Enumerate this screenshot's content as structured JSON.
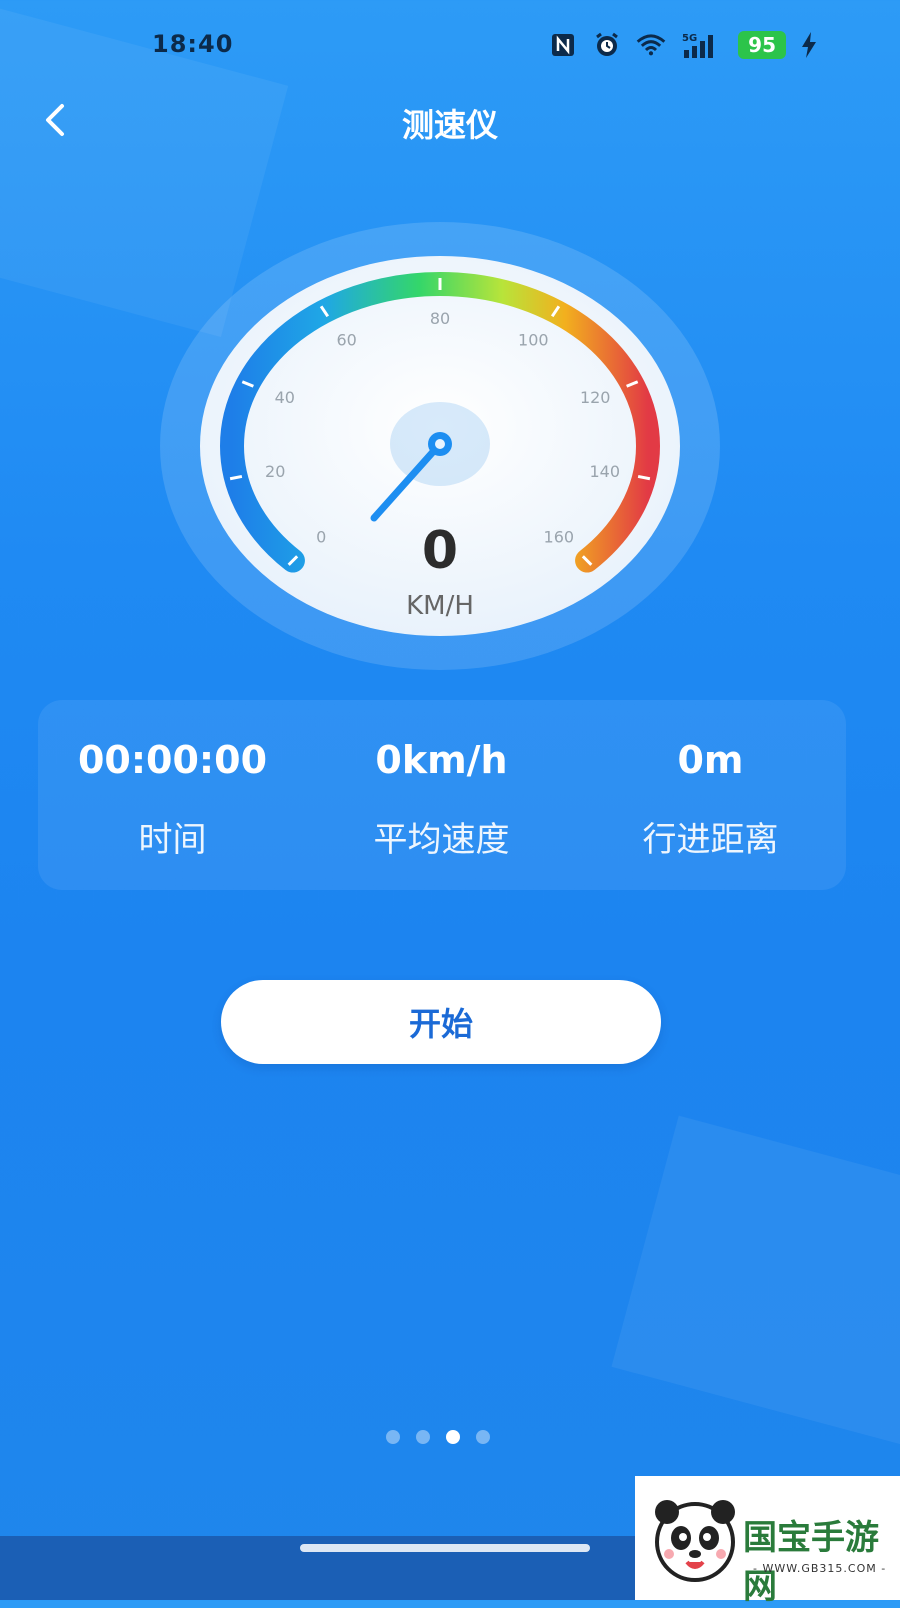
{
  "status_bar": {
    "time": "18:40",
    "icons": [
      "nfc-icon",
      "alarm-icon",
      "wifi-icon",
      "signal-5g-icon",
      "charging-icon"
    ],
    "battery": "95",
    "network_label": "5G"
  },
  "header": {
    "title": "测速仪",
    "back_icon": "chevron-left-icon"
  },
  "speedometer": {
    "speed_value": "0",
    "unit": "KM/H",
    "scale_labels": [
      "0",
      "20",
      "40",
      "60",
      "80",
      "100",
      "120",
      "140",
      "160"
    ],
    "min": 0,
    "max": 160,
    "current": 0
  },
  "stats": {
    "time_value": "00:00:00",
    "time_label": "时间",
    "avg_speed_value": "0km/h",
    "avg_speed_label": "平均速度",
    "distance_value": "0m",
    "distance_label": "行进距离"
  },
  "actions": {
    "start_label": "开始"
  },
  "pager": {
    "count": 4,
    "active_index": 2
  },
  "watermark": {
    "brand": "国宝手游网",
    "url": "- WWW.GB315.COM -"
  },
  "colors": {
    "background": "#1f8af3",
    "button_text": "#1b6ad6",
    "gauge_start": "#1e88e5",
    "gauge_mid": "#3ddc5c",
    "gauge_end": "#e53935"
  }
}
